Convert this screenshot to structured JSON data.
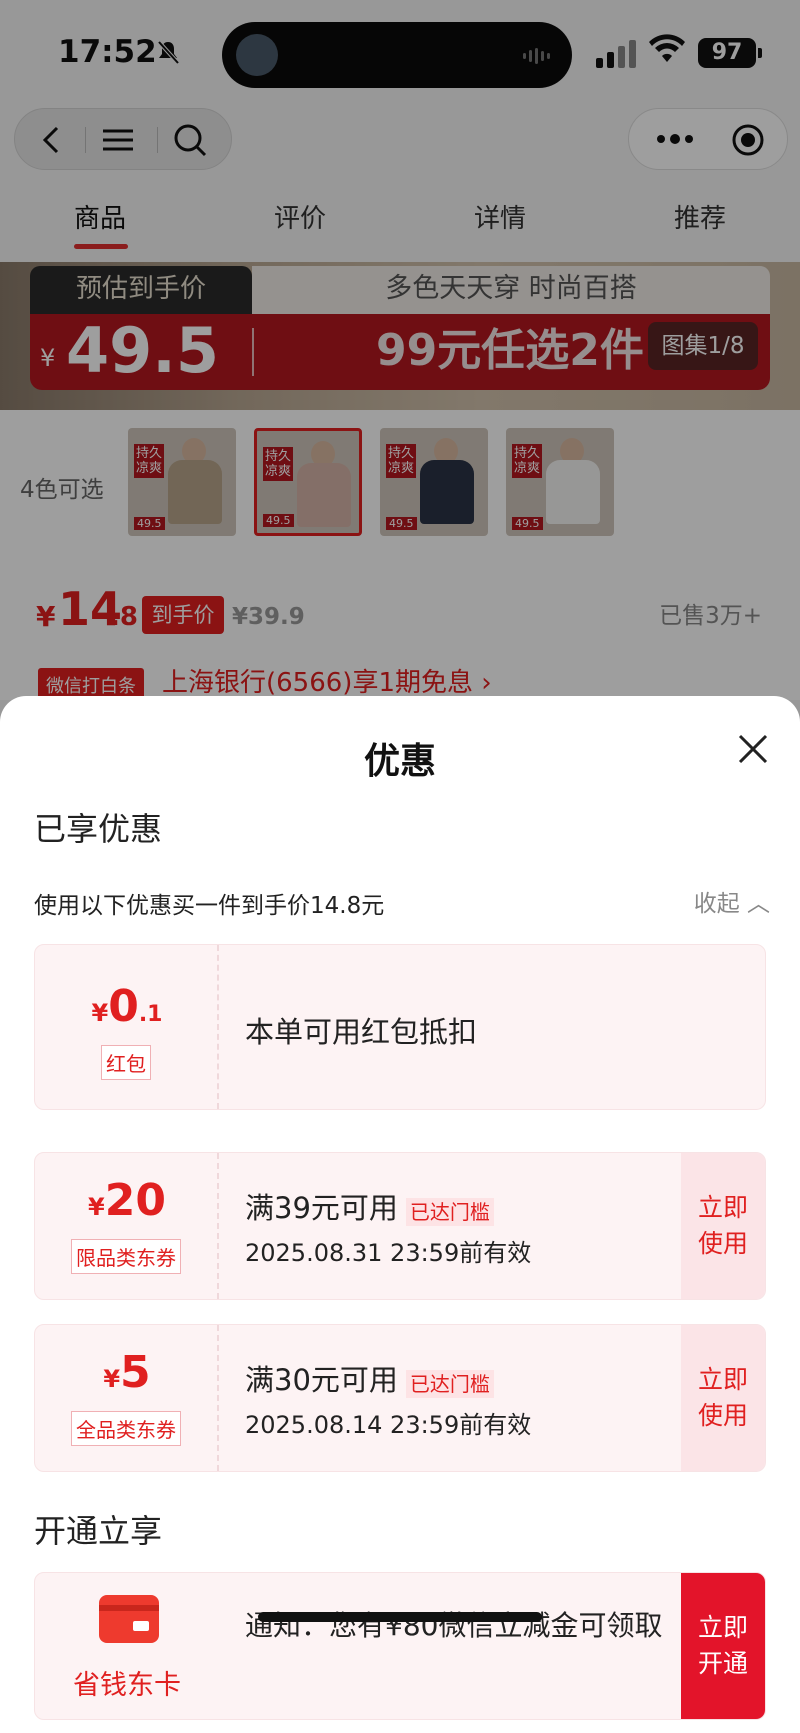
{
  "status_bar": {
    "time": "17:52",
    "battery": "97"
  },
  "tabs": [
    {
      "label": "商品",
      "active": true
    },
    {
      "label": "评价"
    },
    {
      "label": "详情"
    },
    {
      "label": "推荐"
    }
  ],
  "banner": {
    "tag": "预估到手价",
    "slogan": "多色天天穿 时尚百搭",
    "currency": "¥",
    "price": "49.5",
    "promo": "99元任选2件",
    "gallery": "图集1/8"
  },
  "colors": {
    "label": "4色可选",
    "swatches": [
      {
        "name": "beige",
        "color": "#b8a58c",
        "tag": "持久凉爽",
        "price": "49.5"
      },
      {
        "name": "pink",
        "color": "#d6b3a8",
        "tag": "持久凉爽",
        "price": "49.5"
      },
      {
        "name": "navy",
        "color": "#2a3346",
        "tag": "持久凉爽",
        "price": "49.5"
      },
      {
        "name": "white",
        "color": "#f4f4f2",
        "tag": "持久凉爽",
        "price": "49.5"
      }
    ]
  },
  "price_row": {
    "currency": "¥",
    "main": "14",
    "decimal": ".8",
    "badge": "到手价",
    "original": "¥39.9",
    "sold": "已售3万+",
    "wechat": "微信打白条",
    "bank": "上海银行(6566)享1期免息 ›"
  },
  "sheet": {
    "title": "优惠",
    "enjoyed_title": "已享优惠",
    "description": "使用以下优惠买一件到手价14.8元",
    "collapse": "收起 ︿",
    "cards": [
      {
        "currency": "¥",
        "amount": "0",
        "small": ".1",
        "tag": "红包",
        "text": "本单可用红包抵扣"
      },
      {
        "currency": "¥",
        "amount": "20",
        "tag": "限品类东券",
        "text": "满39元可用",
        "reached": "已达门槛",
        "expiry": "2025.08.31 23:59前有效",
        "button": "立即使用"
      },
      {
        "currency": "¥",
        "amount": "5",
        "tag": "全品类东券",
        "text": "满30元可用",
        "reached": "已达门槛",
        "expiry": "2025.08.14 23:59前有效",
        "button": "立即使用"
      }
    ],
    "open_title": "开通立享",
    "open_card": {
      "name": "省钱东卡",
      "text": "通知：您有¥80微信立减金可领取",
      "button": "立即开通"
    }
  },
  "colors_theme": {
    "accent": "#e02020",
    "banner_red": "#b3181f"
  }
}
